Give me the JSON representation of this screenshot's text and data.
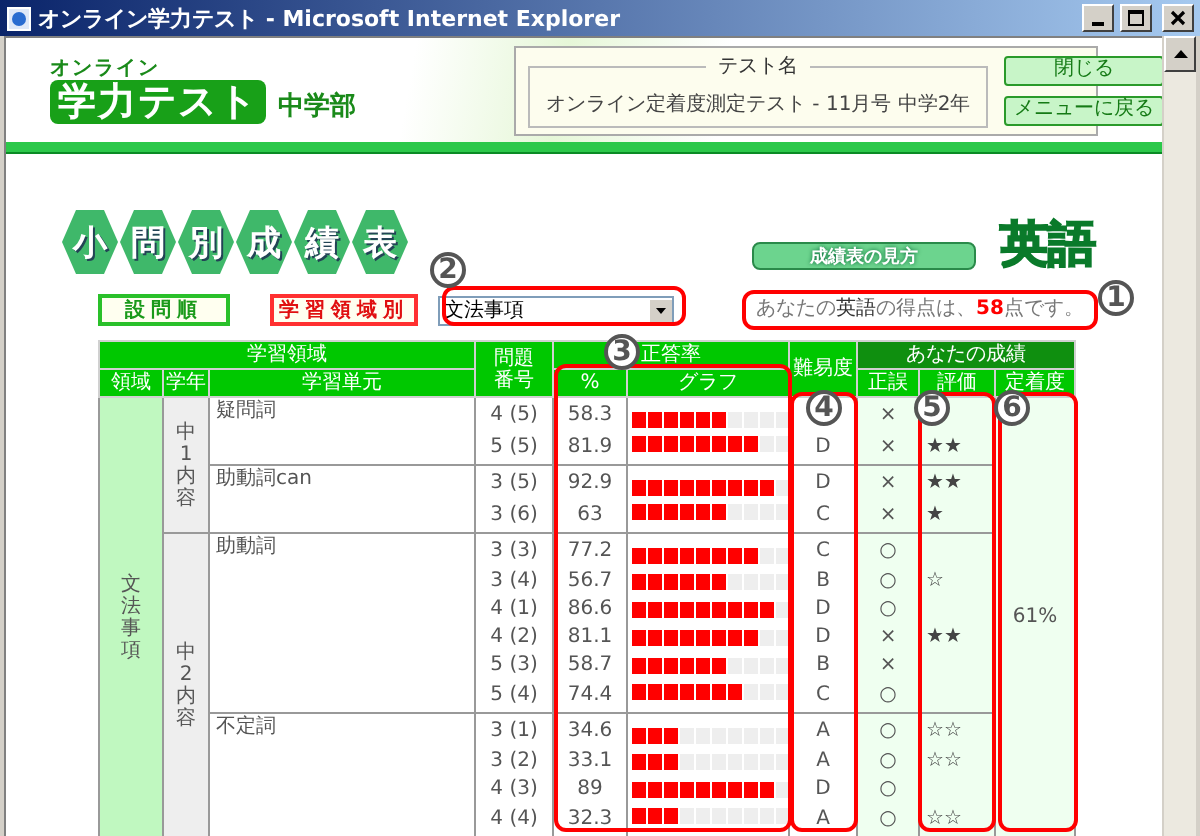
{
  "window": {
    "title": "オンライン学力テスト - Microsoft Internet Explorer"
  },
  "logo": {
    "ruby": "オンライン",
    "main": "学力テスト",
    "division": "中学部"
  },
  "test_name": {
    "legend": "テスト名",
    "value": "オンライン定着度測定テスト - 11月号 中学2年"
  },
  "header_buttons": [
    "閉じる",
    "メニューに戻る"
  ],
  "title_tiles": [
    "小",
    "問",
    "別",
    "成",
    "績",
    "表"
  ],
  "guide_button": "成績表の見方",
  "subject": "英語",
  "view_tabs": [
    {
      "label": "設問順",
      "selected": false
    },
    {
      "label": "学習領域別",
      "selected": true
    }
  ],
  "domain_select": {
    "value": "文法事項"
  },
  "score": {
    "prefix": "あなたの",
    "subject": "英語",
    "middle": "の得点は、",
    "points": "58",
    "suffix": "点です。"
  },
  "columns": {
    "area": "学習領域",
    "domain": "領域",
    "grade": "学年",
    "unit": "学習単元",
    "number": "問題番号",
    "rate": "正答率",
    "percent": "%",
    "graph": "グラフ",
    "difficulty": "難易度",
    "yours": "あなたの成績",
    "result": "正誤",
    "evaluation": "評価",
    "retention": "定着度"
  },
  "retention": "61%",
  "domains": [
    {
      "name": "文法事項",
      "children": [
        {
          "name": "中1内容",
          "children": [
            {
              "name": "疑問詞",
              "questions": [
                {
                  "number": "4 (5)",
                  "percent": "58.3",
                  "level": 0.583,
                  "result": "×"
                },
                {
                  "number": "5 (5)",
                  "percent": "81.9",
                  "level": 0.819,
                  "difficulty": "D",
                  "result": "×",
                  "evaluation": "★★"
                }
              ]
            },
            {
              "name": "助動詞can",
              "questions": [
                {
                  "number": "3 (5)",
                  "percent": "92.9",
                  "level": 0.929,
                  "difficulty": "D",
                  "result": "×",
                  "evaluation": "★★"
                },
                {
                  "number": "3 (6)",
                  "percent": "63",
                  "level": 0.63,
                  "difficulty": "C",
                  "result": "×",
                  "evaluation": "★"
                }
              ]
            }
          ]
        },
        {
          "name": "中2内容",
          "children": [
            {
              "name": "助動詞",
              "questions": [
                {
                  "number": "3 (3)",
                  "percent": "77.2",
                  "level": 0.772,
                  "difficulty": "C",
                  "result": "○"
                },
                {
                  "number": "3 (4)",
                  "percent": "56.7",
                  "level": 0.567,
                  "difficulty": "B",
                  "result": "○",
                  "evaluation": "☆"
                },
                {
                  "number": "4 (1)",
                  "percent": "86.6",
                  "level": 0.866,
                  "difficulty": "D",
                  "result": "○"
                },
                {
                  "number": "4 (2)",
                  "percent": "81.1",
                  "level": 0.811,
                  "difficulty": "D",
                  "result": "×",
                  "evaluation": "★★"
                },
                {
                  "number": "5 (3)",
                  "percent": "58.7",
                  "level": 0.587,
                  "difficulty": "B",
                  "result": "×"
                },
                {
                  "number": "5 (4)",
                  "percent": "74.4",
                  "level": 0.744,
                  "difficulty": "C",
                  "result": "○"
                }
              ]
            },
            {
              "name": "不定詞",
              "questions": [
                {
                  "number": "3 (1)",
                  "percent": "34.6",
                  "level": 0.346,
                  "difficulty": "A",
                  "result": "○",
                  "evaluation": "☆☆"
                },
                {
                  "number": "3 (2)",
                  "percent": "33.1",
                  "level": 0.331,
                  "difficulty": "A",
                  "result": "○",
                  "evaluation": "☆☆"
                },
                {
                  "number": "4 (3)",
                  "percent": "89",
                  "level": 0.89,
                  "difficulty": "D",
                  "result": "○"
                },
                {
                  "number": "4 (4)",
                  "percent": "32.3",
                  "level": 0.323,
                  "difficulty": "A",
                  "result": "○",
                  "evaluation": "☆☆"
                }
              ]
            }
          ]
        }
      ]
    }
  ],
  "annotations": [
    {
      "label": "1"
    },
    {
      "label": "2"
    },
    {
      "label": "3"
    },
    {
      "label": "4"
    },
    {
      "label": "5"
    },
    {
      "label": "6"
    }
  ]
}
